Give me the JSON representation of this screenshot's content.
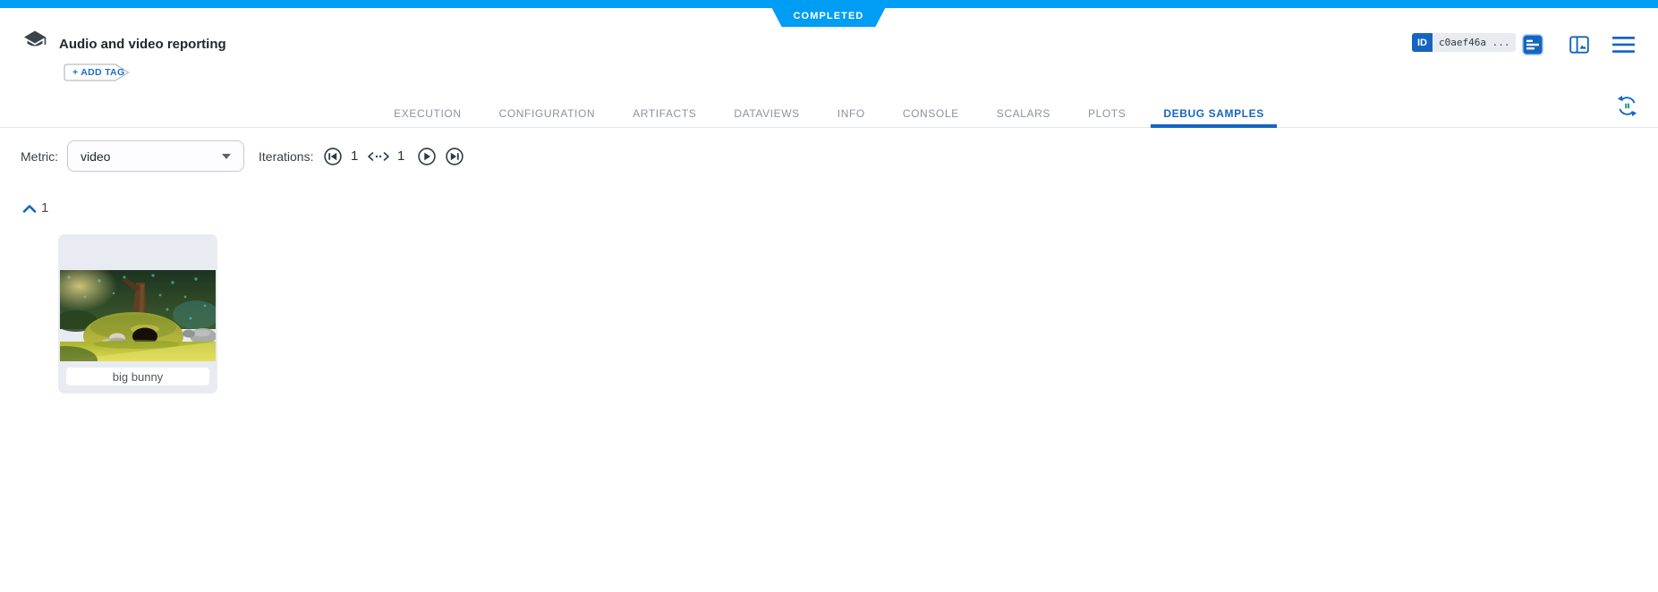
{
  "banner": {
    "status": "COMPLETED"
  },
  "header": {
    "title": "Audio and video reporting",
    "add_tag": "+ ADD TAG",
    "id_label": "ID",
    "id_value": "c0aef46a ..."
  },
  "tabs": [
    {
      "label": "EXECUTION"
    },
    {
      "label": "CONFIGURATION"
    },
    {
      "label": "ARTIFACTS"
    },
    {
      "label": "DATAVIEWS"
    },
    {
      "label": "INFO"
    },
    {
      "label": "CONSOLE"
    },
    {
      "label": "SCALARS"
    },
    {
      "label": "PLOTS"
    },
    {
      "label": "DEBUG SAMPLES",
      "active": true
    }
  ],
  "toolbar": {
    "metric_label": "Metric:",
    "metric_value": "video",
    "iterations_label": "Iterations:",
    "iteration_from": "1",
    "iteration_to": "1"
  },
  "samples": {
    "group_label": "1",
    "items": [
      {
        "caption": "big bunny"
      }
    ]
  },
  "icons": [
    "experiment-icon",
    "id-badge",
    "details-icon",
    "side-panel-icon",
    "menu-icon",
    "auto-refresh-icon",
    "first-iteration-icon",
    "range-icon",
    "next-iteration-icon",
    "last-iteration-icon",
    "collapse-chevron-icon",
    "dropdown-caret-icon"
  ],
  "colors": {
    "status_bar_blue": "#009df4",
    "primary_blue": "#1565c0",
    "tab_inactive_gray": "#8d939b",
    "card_background": "#e9ebf3",
    "icon_slate": "#2e3a46",
    "refresh_dot_green": "#18a188"
  }
}
